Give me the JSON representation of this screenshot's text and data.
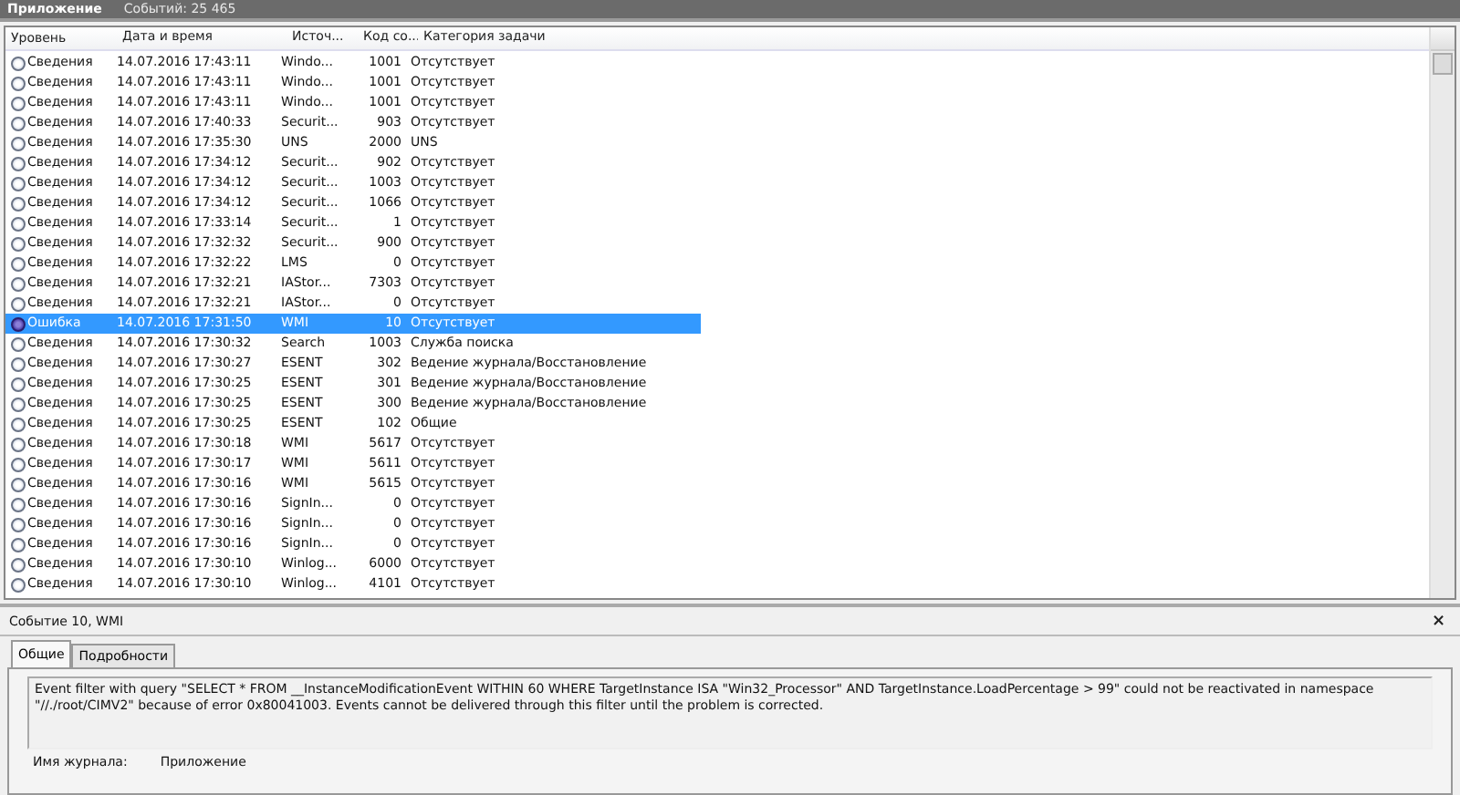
{
  "header": {
    "title": "Приложение",
    "count": "Событий: 25 465"
  },
  "table": {
    "columns": [
      "Уровень",
      "Дата и время",
      "Источ...",
      "Код со...",
      "Категория задачи"
    ],
    "rows": [
      {
        "level": "Сведения",
        "kind": "info",
        "date": "14.07.2016 17:43:11",
        "source": "Windo...",
        "code": "1001",
        "category": "Отсутствует",
        "selected": false
      },
      {
        "level": "Сведения",
        "kind": "info",
        "date": "14.07.2016 17:43:11",
        "source": "Windo...",
        "code": "1001",
        "category": "Отсутствует",
        "selected": false
      },
      {
        "level": "Сведения",
        "kind": "info",
        "date": "14.07.2016 17:43:11",
        "source": "Windo...",
        "code": "1001",
        "category": "Отсутствует",
        "selected": false
      },
      {
        "level": "Сведения",
        "kind": "info",
        "date": "14.07.2016 17:40:33",
        "source": "Securit...",
        "code": "903",
        "category": "Отсутствует",
        "selected": false
      },
      {
        "level": "Сведения",
        "kind": "info",
        "date": "14.07.2016 17:35:30",
        "source": "UNS",
        "code": "2000",
        "category": "UNS",
        "selected": false
      },
      {
        "level": "Сведения",
        "kind": "info",
        "date": "14.07.2016 17:34:12",
        "source": "Securit...",
        "code": "902",
        "category": "Отсутствует",
        "selected": false
      },
      {
        "level": "Сведения",
        "kind": "info",
        "date": "14.07.2016 17:34:12",
        "source": "Securit...",
        "code": "1003",
        "category": "Отсутствует",
        "selected": false
      },
      {
        "level": "Сведения",
        "kind": "info",
        "date": "14.07.2016 17:34:12",
        "source": "Securit...",
        "code": "1066",
        "category": "Отсутствует",
        "selected": false
      },
      {
        "level": "Сведения",
        "kind": "info",
        "date": "14.07.2016 17:33:14",
        "source": "Securit...",
        "code": "1",
        "category": "Отсутствует",
        "selected": false
      },
      {
        "level": "Сведения",
        "kind": "info",
        "date": "14.07.2016 17:32:32",
        "source": "Securit...",
        "code": "900",
        "category": "Отсутствует",
        "selected": false
      },
      {
        "level": "Сведения",
        "kind": "info",
        "date": "14.07.2016 17:32:22",
        "source": "LMS",
        "code": "0",
        "category": "Отсутствует",
        "selected": false
      },
      {
        "level": "Сведения",
        "kind": "info",
        "date": "14.07.2016 17:32:21",
        "source": "IAStor...",
        "code": "7303",
        "category": "Отсутствует",
        "selected": false
      },
      {
        "level": "Сведения",
        "kind": "info",
        "date": "14.07.2016 17:32:21",
        "source": "IAStor...",
        "code": "0",
        "category": "Отсутствует",
        "selected": false
      },
      {
        "level": "Ошибка",
        "kind": "error",
        "date": "14.07.2016 17:31:50",
        "source": "WMI",
        "code": "10",
        "category": "Отсутствует",
        "selected": true
      },
      {
        "level": "Сведения",
        "kind": "info",
        "date": "14.07.2016 17:30:32",
        "source": "Search",
        "code": "1003",
        "category": "Служба поиска",
        "selected": false
      },
      {
        "level": "Сведения",
        "kind": "info",
        "date": "14.07.2016 17:30:27",
        "source": "ESENT",
        "code": "302",
        "category": "Ведение журнала/Восстановление",
        "selected": false
      },
      {
        "level": "Сведения",
        "kind": "info",
        "date": "14.07.2016 17:30:25",
        "source": "ESENT",
        "code": "301",
        "category": "Ведение журнала/Восстановление",
        "selected": false
      },
      {
        "level": "Сведения",
        "kind": "info",
        "date": "14.07.2016 17:30:25",
        "source": "ESENT",
        "code": "300",
        "category": "Ведение журнала/Восстановление",
        "selected": false
      },
      {
        "level": "Сведения",
        "kind": "info",
        "date": "14.07.2016 17:30:25",
        "source": "ESENT",
        "code": "102",
        "category": "Общие",
        "selected": false
      },
      {
        "level": "Сведения",
        "kind": "info",
        "date": "14.07.2016 17:30:18",
        "source": "WMI",
        "code": "5617",
        "category": "Отсутствует",
        "selected": false
      },
      {
        "level": "Сведения",
        "kind": "info",
        "date": "14.07.2016 17:30:17",
        "source": "WMI",
        "code": "5611",
        "category": "Отсутствует",
        "selected": false
      },
      {
        "level": "Сведения",
        "kind": "info",
        "date": "14.07.2016 17:30:16",
        "source": "WMI",
        "code": "5615",
        "category": "Отсутствует",
        "selected": false
      },
      {
        "level": "Сведения",
        "kind": "info",
        "date": "14.07.2016 17:30:16",
        "source": "SignIn...",
        "code": "0",
        "category": "Отсутствует",
        "selected": false
      },
      {
        "level": "Сведения",
        "kind": "info",
        "date": "14.07.2016 17:30:16",
        "source": "SignIn...",
        "code": "0",
        "category": "Отсутствует",
        "selected": false
      },
      {
        "level": "Сведения",
        "kind": "info",
        "date": "14.07.2016 17:30:16",
        "source": "SignIn...",
        "code": "0",
        "category": "Отсутствует",
        "selected": false
      },
      {
        "level": "Сведения",
        "kind": "info",
        "date": "14.07.2016 17:30:10",
        "source": "Winlog...",
        "code": "6000",
        "category": "Отсутствует",
        "selected": false
      },
      {
        "level": "Сведения",
        "kind": "info",
        "date": "14.07.2016 17:30:10",
        "source": "Winlog...",
        "code": "4101",
        "category": "Отсутствует",
        "selected": false
      }
    ]
  },
  "details": {
    "title": "Событие 10, WMI",
    "close": "×",
    "tabs": [
      {
        "label": "Общие",
        "selected": true
      },
      {
        "label": "Подробности",
        "selected": false
      }
    ],
    "message": "Event filter with query \"SELECT * FROM __InstanceModificationEvent WITHIN 60 WHERE TargetInstance ISA \"Win32_Processor\" AND TargetInstance.LoadPercentage > 99\" could not be reactivated in namespace \"//./root/CIMV2\" because of error 0x80041003. Events cannot be delivered through this filter until the problem is corrected.",
    "fields": [
      {
        "label": "Имя журнала:",
        "value": "Приложение"
      }
    ]
  }
}
